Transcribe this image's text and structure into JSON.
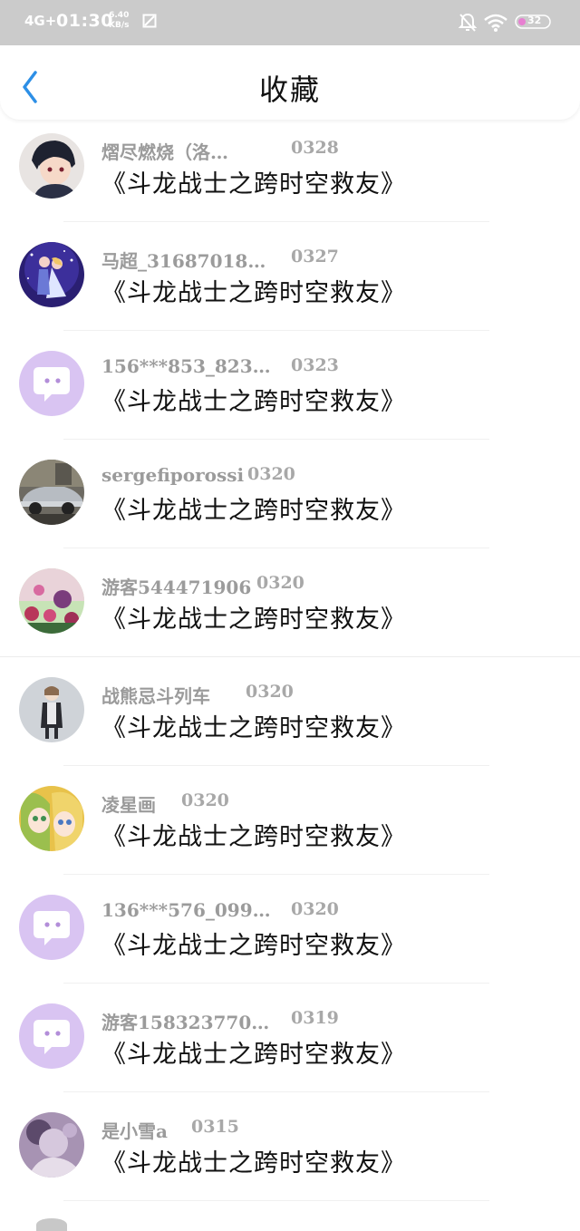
{
  "status_bar": {
    "network": "4G+",
    "time": "01:30",
    "speed_value": "6.40",
    "speed_unit": "KB/s",
    "battery": "32"
  },
  "header": {
    "title": "收藏"
  },
  "items": [
    {
      "name": "熠尽燃烧（洛…",
      "date": "0328",
      "book": "《斗龙战士之跨时空救友》",
      "avatar": "boy-anime"
    },
    {
      "name": "马超_31687018…",
      "date": "0327",
      "book": "《斗龙战士之跨时空救友》",
      "avatar": "couple-stars"
    },
    {
      "name": "156***853_823…",
      "date": "0323",
      "book": "《斗龙战士之跨时空救友》",
      "avatar": "default-bubble"
    },
    {
      "name": "sergefiporossi",
      "date": "0320",
      "book": "《斗龙战士之跨时空救友》",
      "avatar": "car"
    },
    {
      "name": "游客544471906",
      "date": "0320",
      "book": "《斗龙战士之跨时空救友》",
      "avatar": "flowers"
    },
    {
      "name": "战熊忌斗列车",
      "date": "0320",
      "book": "《斗龙战士之跨时空救友》",
      "avatar": "girl-standing"
    },
    {
      "name": "凌星画",
      "date": "0320",
      "book": "《斗龙战士之跨时空救友》",
      "avatar": "two-girls"
    },
    {
      "name": "136***576_099…",
      "date": "0320",
      "book": "《斗龙战士之跨时空救友》",
      "avatar": "default-bubble"
    },
    {
      "name": "游客158323770…",
      "date": "0319",
      "book": "《斗龙战士之跨时空救友》",
      "avatar": "default-bubble"
    },
    {
      "name": "是小雪a",
      "date": "0315",
      "book": "《斗龙战士之跨时空救友》",
      "avatar": "purple-photo"
    }
  ],
  "colors": {
    "accent": "#2d8fe6",
    "default_avatar_bg": "#d9c4f2",
    "status_bar_bg": "#cbcbcb"
  }
}
